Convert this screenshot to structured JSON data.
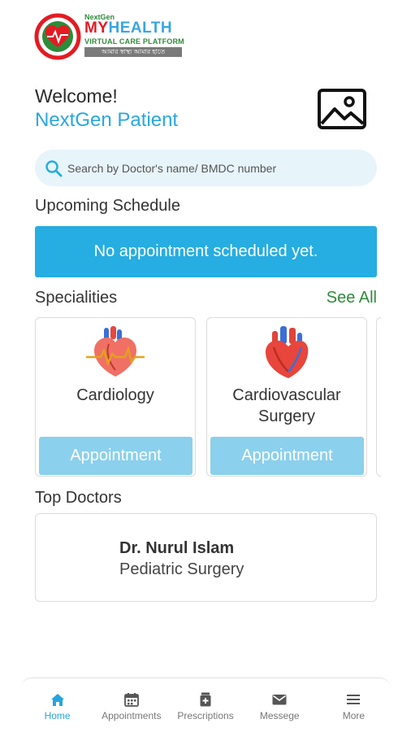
{
  "logo": {
    "brand_small": "NextGen",
    "brand_my": "MY",
    "brand_health": "HEALTH",
    "brand_sub": "VIRTUAL CARE PLATFORM",
    "brand_tag": "আমার স্বাস্থ্য আমার হাতে"
  },
  "header": {
    "welcome": "Welcome!",
    "patient_name": "NextGen Patient"
  },
  "search": {
    "placeholder": "Search by Doctor's name/ BMDC number"
  },
  "schedule": {
    "title": "Upcoming Schedule",
    "empty_message": "No appointment scheduled yet."
  },
  "specialities": {
    "title": "Specialities",
    "see_all": "See All",
    "items": [
      {
        "name": "Cardiology",
        "button": "Appointment",
        "icon": "heart-pulse-icon"
      },
      {
        "name": "Cardiovascular Surgery",
        "button": "Appointment",
        "icon": "anatomical-heart-icon"
      }
    ]
  },
  "top_doctors": {
    "title": "Top Doctors",
    "items": [
      {
        "name": "Dr. Nurul Islam",
        "speciality": "Pediatric Surgery"
      }
    ]
  },
  "nav": {
    "items": [
      {
        "label": "Home",
        "icon": "home-icon",
        "active": true
      },
      {
        "label": "Appointments",
        "icon": "calendar-icon",
        "active": false
      },
      {
        "label": "Prescriptions",
        "icon": "prescription-icon",
        "active": false
      },
      {
        "label": "Messege",
        "icon": "mail-icon",
        "active": false
      },
      {
        "label": "More",
        "icon": "menu-icon",
        "active": false
      }
    ]
  },
  "colors": {
    "primary": "#26ade1",
    "button_light": "#8bd0ec",
    "search_bg": "#e7f4fa",
    "see_all": "#2e8b3a",
    "logo_red": "#e31b23"
  }
}
